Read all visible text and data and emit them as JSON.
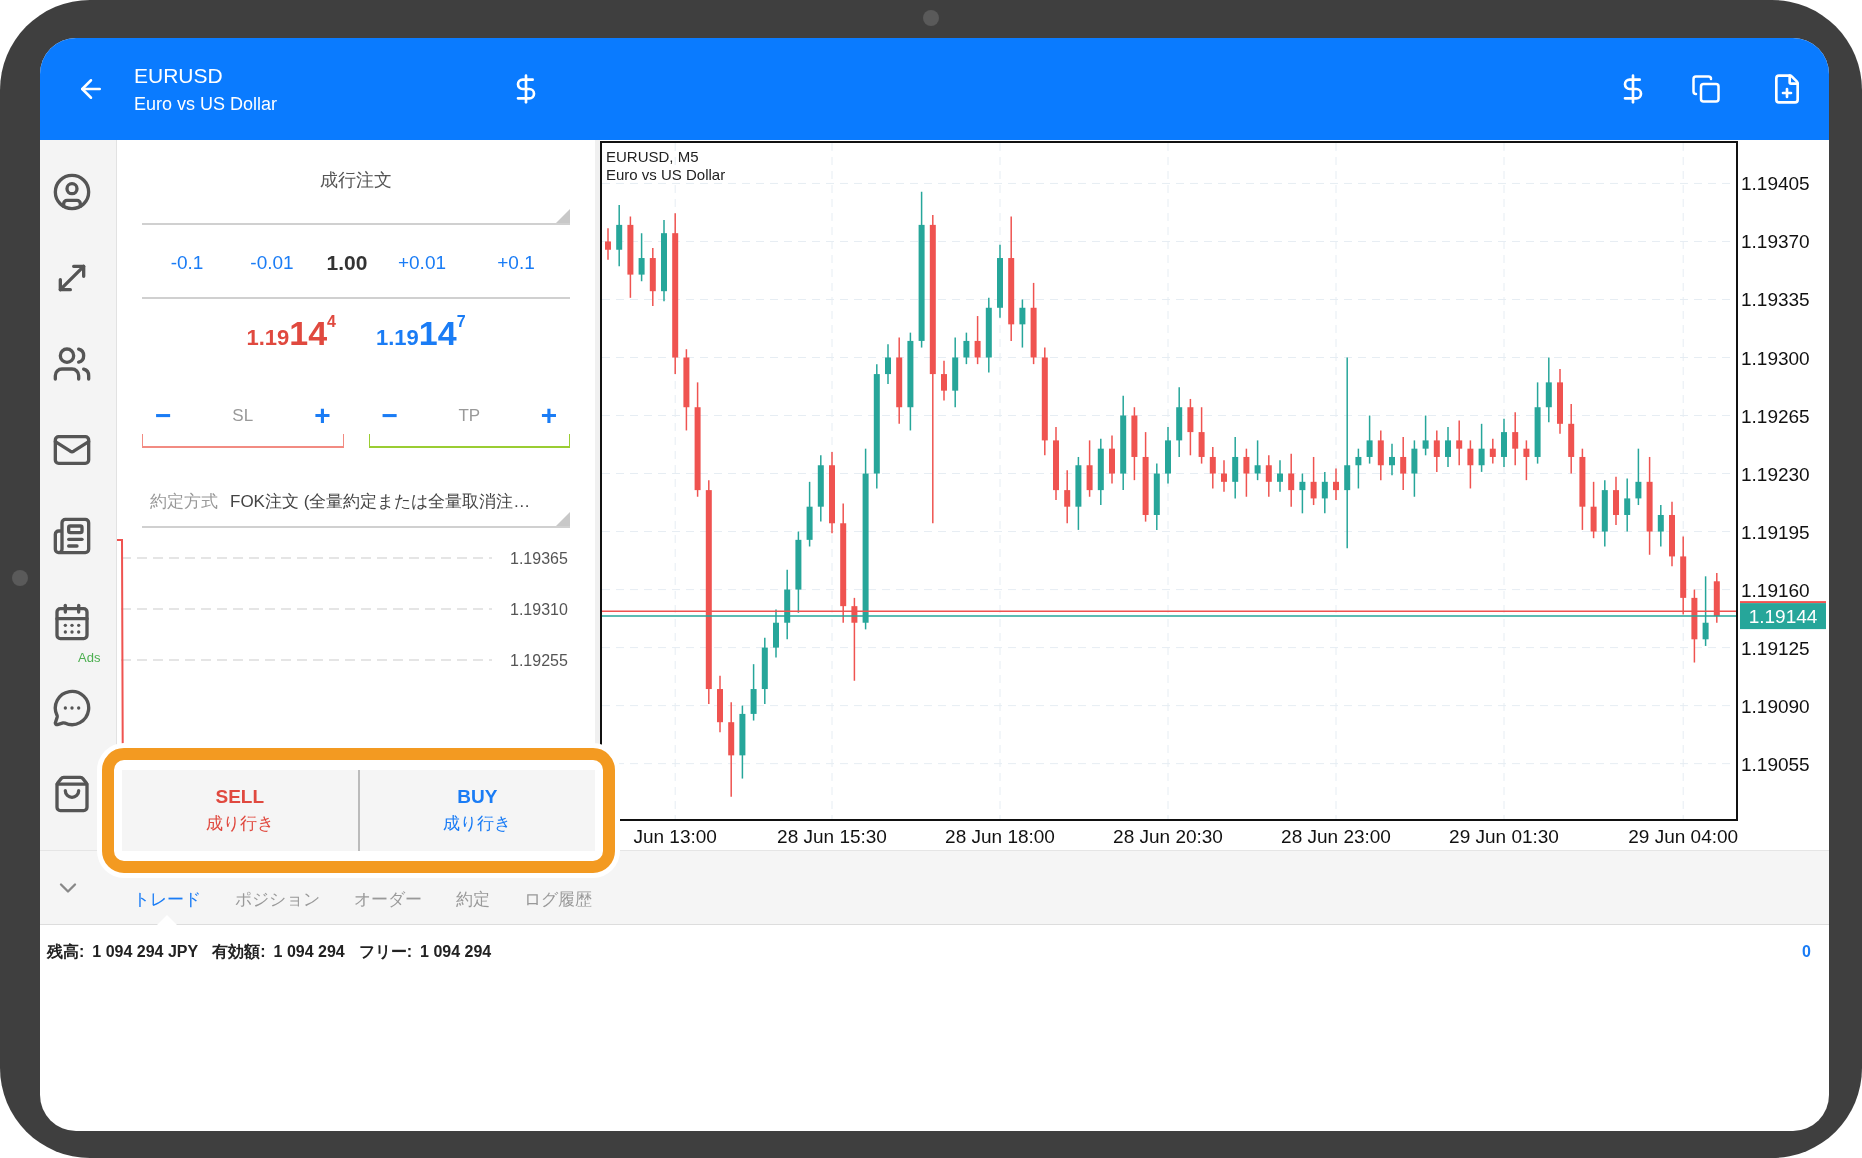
{
  "header": {
    "symbol": "EURUSD",
    "description": "Euro vs US Dollar"
  },
  "sidebar": {
    "ads_label": "Ads"
  },
  "order": {
    "type": "成行注文",
    "volume": {
      "decrease": [
        "-0.1",
        "-0.01"
      ],
      "value": "1.00",
      "increase": [
        "+0.01",
        "+0.1"
      ]
    },
    "bid": {
      "head": "1.19",
      "big": "14",
      "tail": "4"
    },
    "ask": {
      "head": "1.19",
      "big": "14",
      "tail": "7"
    },
    "stops": [
      {
        "kind": "sl",
        "minus": "−",
        "label": "SL",
        "plus": "+"
      },
      {
        "kind": "tp",
        "minus": "−",
        "label": "TP",
        "plus": "+"
      }
    ],
    "fill_policy": {
      "label": "約定方式",
      "value": "FOK注文 (全量約定または全量取消注…"
    },
    "mini_chart": {
      "y_labels": [
        "1.19365",
        "1.19310",
        "1.19255"
      ]
    },
    "buttons": [
      {
        "kind": "sell",
        "label": "SELL",
        "sub": "成り行き"
      },
      {
        "kind": "buy",
        "label": "BUY",
        "sub": "成り行き"
      }
    ]
  },
  "chart": {
    "subtitle": "Euro vs US Dollar",
    "chart_data": {
      "type": "candlestick",
      "title": "EURUSD, M5",
      "categories": [
        null,
        null,
        null,
        null,
        null,
        null,
        "Jun 13:00",
        null,
        null,
        null,
        null,
        null,
        null,
        null,
        null,
        null,
        null,
        null,
        null,
        null,
        "28 Jun 15:30",
        null,
        null,
        null,
        null,
        null,
        null,
        null,
        null,
        null,
        null,
        null,
        null,
        null,
        null,
        "28 Jun 18:00",
        null,
        null,
        null,
        null,
        null,
        null,
        null,
        null,
        null,
        null,
        null,
        null,
        null,
        null,
        "28 Jun 20:30",
        null,
        null,
        null,
        null,
        null,
        null,
        null,
        null,
        null,
        null,
        null,
        null,
        null,
        null,
        "28 Jun 23:00",
        null,
        null,
        null,
        null,
        null,
        null,
        null,
        null,
        null,
        null,
        null,
        null,
        null,
        null,
        "29 Jun 01:30",
        null,
        null,
        null,
        null,
        null,
        null,
        null,
        null,
        null,
        null,
        null,
        null,
        null,
        null,
        null,
        "29 Jun 04:00",
        null,
        null,
        null
      ],
      "ohlc": [
        [
          1.1937,
          1.19378,
          1.19359,
          1.19365
        ],
        [
          1.19365,
          1.19392,
          1.19355,
          1.1938
        ],
        [
          1.1938,
          1.19385,
          1.19336,
          1.1935
        ],
        [
          1.1935,
          1.19375,
          1.19346,
          1.1936
        ],
        [
          1.1936,
          1.19366,
          1.19331,
          1.1934
        ],
        [
          1.1934,
          1.19383,
          1.19334,
          1.19375
        ],
        [
          1.19375,
          1.19387,
          1.1929,
          1.193
        ],
        [
          1.193,
          1.19305,
          1.19256,
          1.1927
        ],
        [
          1.1927,
          1.19285,
          1.19216,
          1.1922
        ],
        [
          1.1922,
          1.19226,
          1.19091,
          1.191
        ],
        [
          1.191,
          1.19108,
          1.19074,
          1.1908
        ],
        [
          1.1908,
          1.19092,
          1.19035,
          1.1906
        ],
        [
          1.1906,
          1.1909,
          1.19046,
          1.19085
        ],
        [
          1.19085,
          1.19115,
          1.19081,
          1.191
        ],
        [
          1.191,
          1.19131,
          1.19091,
          1.19125
        ],
        [
          1.19125,
          1.19148,
          1.19119,
          1.1914
        ],
        [
          1.1914,
          1.19172,
          1.1913,
          1.1916
        ],
        [
          1.1916,
          1.19195,
          1.19146,
          1.1919
        ],
        [
          1.1919,
          1.19225,
          1.19186,
          1.1921
        ],
        [
          1.1921,
          1.19241,
          1.19201,
          1.19235
        ],
        [
          1.19235,
          1.19243,
          1.19194,
          1.192
        ],
        [
          1.192,
          1.19212,
          1.1914,
          1.1915
        ],
        [
          1.1915,
          1.19155,
          1.19105,
          1.1914
        ],
        [
          1.1914,
          1.19245,
          1.19136,
          1.1923
        ],
        [
          1.1923,
          1.19296,
          1.19221,
          1.1929
        ],
        [
          1.1929,
          1.19308,
          1.19284,
          1.193
        ],
        [
          1.193,
          1.19312,
          1.1926,
          1.1927
        ],
        [
          1.1927,
          1.19315,
          1.19256,
          1.1931
        ],
        [
          1.1931,
          1.194,
          1.19306,
          1.1938
        ],
        [
          1.1938,
          1.19386,
          1.192,
          1.1929
        ],
        [
          1.1929,
          1.19298,
          1.19274,
          1.1928
        ],
        [
          1.1928,
          1.19312,
          1.1927,
          1.193
        ],
        [
          1.193,
          1.19315,
          1.19296,
          1.1931
        ],
        [
          1.1931,
          1.19325,
          1.19296,
          1.193
        ],
        [
          1.193,
          1.19336,
          1.19291,
          1.1933
        ],
        [
          1.1933,
          1.19368,
          1.19324,
          1.1936
        ],
        [
          1.1936,
          1.19385,
          1.1931,
          1.1932
        ],
        [
          1.1932,
          1.19335,
          1.19306,
          1.1933
        ],
        [
          1.1933,
          1.19345,
          1.19296,
          1.193
        ],
        [
          1.193,
          1.19306,
          1.19241,
          1.1925
        ],
        [
          1.1925,
          1.19258,
          1.19214,
          1.1922
        ],
        [
          1.1922,
          1.19232,
          1.192,
          1.1921
        ],
        [
          1.1921,
          1.1924,
          1.19196,
          1.19235
        ],
        [
          1.19235,
          1.1925,
          1.19216,
          1.1922
        ],
        [
          1.1922,
          1.19251,
          1.19211,
          1.19245
        ],
        [
          1.19245,
          1.19253,
          1.19224,
          1.1923
        ],
        [
          1.1923,
          1.19277,
          1.1922,
          1.19265
        ],
        [
          1.19265,
          1.1927,
          1.19226,
          1.1924
        ],
        [
          1.1924,
          1.19255,
          1.19201,
          1.19205
        ],
        [
          1.19205,
          1.19236,
          1.19196,
          1.1923
        ],
        [
          1.1923,
          1.19258,
          1.19224,
          1.1925
        ],
        [
          1.1925,
          1.19282,
          1.1924,
          1.1927
        ],
        [
          1.1927,
          1.19275,
          1.19241,
          1.19255
        ],
        [
          1.19255,
          1.1927,
          1.19236,
          1.1924
        ],
        [
          1.1924,
          1.19246,
          1.19221,
          1.1923
        ],
        [
          1.1923,
          1.19238,
          1.19219,
          1.19225
        ],
        [
          1.19225,
          1.19252,
          1.19215,
          1.1924
        ],
        [
          1.1924,
          1.19245,
          1.19216,
          1.1923
        ],
        [
          1.1923,
          1.1925,
          1.19226,
          1.19235
        ],
        [
          1.19235,
          1.19241,
          1.19216,
          1.19225
        ],
        [
          1.19225,
          1.19238,
          1.19219,
          1.1923
        ],
        [
          1.1923,
          1.19242,
          1.1921,
          1.1922
        ],
        [
          1.1922,
          1.1923,
          1.19206,
          1.19225
        ],
        [
          1.19225,
          1.1924,
          1.19211,
          1.19215
        ],
        [
          1.19215,
          1.19231,
          1.19206,
          1.19225
        ],
        [
          1.19225,
          1.19233,
          1.19214,
          1.1922
        ],
        [
          1.1922,
          1.193,
          1.19185,
          1.19235
        ],
        [
          1.19235,
          1.19245,
          1.19221,
          1.1924
        ],
        [
          1.1924,
          1.19265,
          1.19236,
          1.1925
        ],
        [
          1.1925,
          1.19256,
          1.19226,
          1.19235
        ],
        [
          1.19235,
          1.19248,
          1.19229,
          1.1924
        ],
        [
          1.1924,
          1.19252,
          1.1922,
          1.1923
        ],
        [
          1.1923,
          1.1925,
          1.19216,
          1.19245
        ],
        [
          1.19245,
          1.19265,
          1.19241,
          1.1925
        ],
        [
          1.1925,
          1.19256,
          1.19231,
          1.1924
        ],
        [
          1.1924,
          1.19258,
          1.19234,
          1.1925
        ],
        [
          1.1925,
          1.19262,
          1.19235,
          1.19245
        ],
        [
          1.19245,
          1.1925,
          1.19221,
          1.19235
        ],
        [
          1.19235,
          1.1926,
          1.19231,
          1.19245
        ],
        [
          1.19245,
          1.19251,
          1.19236,
          1.1924
        ],
        [
          1.1924,
          1.19263,
          1.19234,
          1.19255
        ],
        [
          1.19255,
          1.19267,
          1.19235,
          1.19245
        ],
        [
          1.19245,
          1.1925,
          1.19226,
          1.1924
        ],
        [
          1.1924,
          1.19285,
          1.19236,
          1.1927
        ],
        [
          1.1927,
          1.193,
          1.19261,
          1.19285
        ],
        [
          1.19285,
          1.19293,
          1.19254,
          1.1926
        ],
        [
          1.1926,
          1.19272,
          1.1923,
          1.1924
        ],
        [
          1.1924,
          1.19245,
          1.19196,
          1.1921
        ],
        [
          1.1921,
          1.19225,
          1.19191,
          1.19195
        ],
        [
          1.19195,
          1.19226,
          1.19186,
          1.1922
        ],
        [
          1.1922,
          1.19228,
          1.19199,
          1.19205
        ],
        [
          1.19205,
          1.19227,
          1.19195,
          1.19215
        ],
        [
          1.19215,
          1.19245,
          1.19211,
          1.19225
        ],
        [
          1.19225,
          1.1924,
          1.19181,
          1.19195
        ],
        [
          1.19195,
          1.19211,
          1.19186,
          1.19205
        ],
        [
          1.19205,
          1.19213,
          1.19174,
          1.1918
        ],
        [
          1.1918,
          1.19192,
          1.19145,
          1.19155
        ],
        [
          1.19155,
          1.1916,
          1.19116,
          1.1913
        ],
        [
          1.1913,
          1.19168,
          1.19126,
          1.1914
        ],
        [
          1.19165,
          1.1917,
          1.1914,
          1.19144
        ]
      ],
      "ylim": [
        1.19021,
        1.1943
      ],
      "yticks": [
        {
          "value": 1.19405,
          "label": "1.19405"
        },
        {
          "value": 1.1937,
          "label": "1.19370"
        },
        {
          "value": 1.19335,
          "label": "1.19335"
        },
        {
          "value": 1.193,
          "label": "1.19300"
        },
        {
          "value": 1.19265,
          "label": "1.19265"
        },
        {
          "value": 1.1923,
          "label": "1.19230"
        },
        {
          "value": 1.19195,
          "label": "1.19195"
        },
        {
          "value": 1.1916,
          "label": "1.19160"
        },
        {
          "value": 1.19125,
          "label": "1.19125"
        },
        {
          "value": 1.1909,
          "label": "1.19090"
        },
        {
          "value": 1.19055,
          "label": "1.19055"
        }
      ],
      "grid": true,
      "ref_lines": [
        {
          "axis": "y",
          "value": 1.19147,
          "color": "#ef5350"
        },
        {
          "axis": "y",
          "value": 1.19144,
          "color": "#26a69a",
          "label": "1.19144"
        }
      ]
    }
  },
  "tabs": [
    {
      "label": "トレード",
      "selected": true
    },
    {
      "label": "ポジション",
      "selected": false
    },
    {
      "label": "オーダー",
      "selected": false
    },
    {
      "label": "約定",
      "selected": false
    },
    {
      "label": "ログ履歴",
      "selected": false
    }
  ],
  "status": {
    "balance_label": "残高:",
    "balance": "1 094 294 JPY",
    "equity_label": "有効額:",
    "equity": "1 094 294",
    "free_label": "フリー:",
    "free": "1 094 294",
    "count": "0"
  }
}
